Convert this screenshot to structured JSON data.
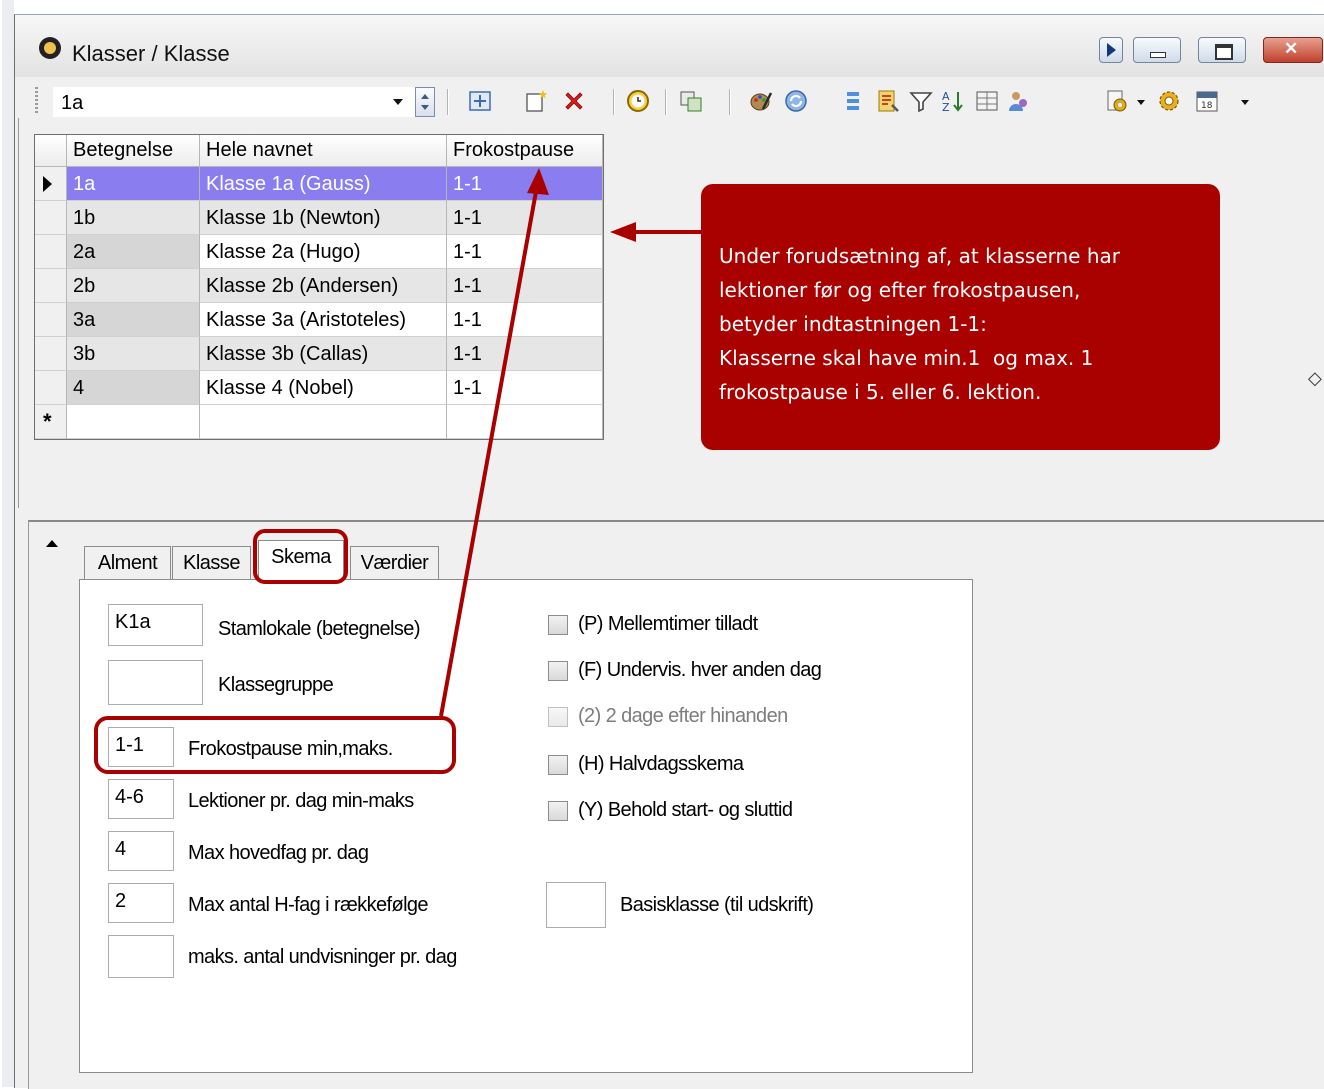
{
  "window": {
    "title": "Klasser / Klasse"
  },
  "toolbar": {
    "selector_value": "1a"
  },
  "grid": {
    "columns": [
      "Betegnelse",
      "Hele navnet",
      "Frokostpause"
    ],
    "rows": [
      [
        "1a",
        "Klasse 1a (Gauss)",
        "1-1"
      ],
      [
        "1b",
        "Klasse 1b (Newton)",
        "1-1"
      ],
      [
        "2a",
        "Klasse 2a (Hugo)",
        "1-1"
      ],
      [
        "2b",
        "Klasse 2b (Andersen)",
        "1-1"
      ],
      [
        "3a",
        "Klasse 3a (Aristoteles)",
        "1-1"
      ],
      [
        "3b",
        "Klasse 3b (Callas)",
        "1-1"
      ],
      [
        "4",
        "Klasse 4 (Nobel)",
        "1-1"
      ]
    ],
    "new_row_marker": "*"
  },
  "callout": {
    "lines": [
      "Under forudsætning af, at klasserne har",
      "lektioner før og efter frokostpausen,",
      "betyder indtastningen 1-1:",
      "Klasserne skal have min.1  og max. 1",
      "frokostpause i 5. eller 6. lektion."
    ],
    "color": "#a90000"
  },
  "tabs": [
    "Alment",
    "Klasse",
    "Skema",
    "Værdier"
  ],
  "active_tab": "Skema",
  "form": {
    "fields": [
      {
        "value": "K1a",
        "label": "Stamlokale (betegnelse)"
      },
      {
        "value": "",
        "label": "Klassegruppe"
      },
      {
        "value": "1-1",
        "label": "Frokostpause min,maks."
      },
      {
        "value": "4-6",
        "label": "Lektioner pr. dag min-maks"
      },
      {
        "value": "4",
        "label": "Max hovedfag pr. dag"
      },
      {
        "value": "2",
        "label": "Max antal H-fag i rækkefølge"
      },
      {
        "value": "",
        "label": "maks. antal undvisninger pr. dag"
      }
    ],
    "checkboxes": [
      {
        "label": "(P) Mellemtimer tilladt",
        "checked": false,
        "enabled": true
      },
      {
        "label": "(F) Undervis. hver anden dag",
        "checked": false,
        "enabled": true
      },
      {
        "label": "(2) 2 dage efter hinanden",
        "checked": false,
        "enabled": false
      },
      {
        "label": "(H) Halvdagsskema",
        "checked": false,
        "enabled": true
      },
      {
        "label": "(Y) Behold start- og sluttid",
        "checked": false,
        "enabled": true
      }
    ],
    "basis": {
      "value": "",
      "label": "Basisklasse (til udskrift)"
    }
  },
  "icons": [
    "clock-icon",
    "view-grid-icon",
    "new-record-icon",
    "delete-icon",
    "time-icon",
    "copy-icon",
    "palette-icon",
    "refresh-icon",
    "list-icon",
    "report-icon",
    "filter-icon",
    "sort-icon",
    "table-icon",
    "people-icon",
    "settings-dropdown-icon",
    "gear-icon",
    "calendar-icon"
  ]
}
